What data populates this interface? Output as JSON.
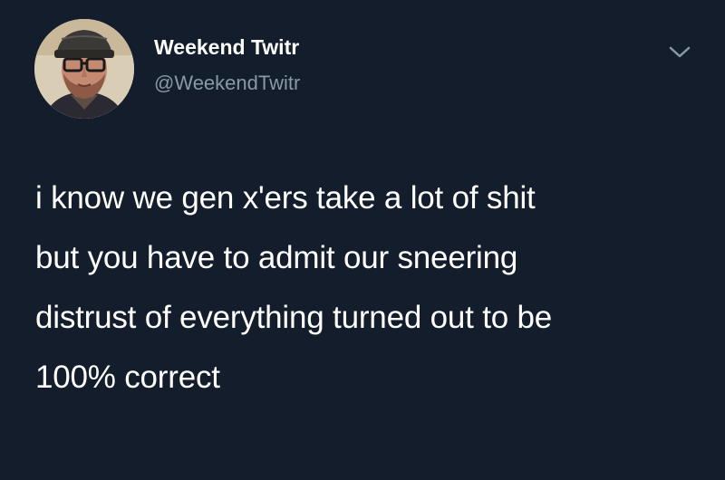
{
  "tweet": {
    "author": {
      "display_name": "Weekend Twitr",
      "handle": "@WeekendTwitr"
    },
    "text_lines": [
      "i know we gen x'ers take a lot of shit",
      "but you have to admit our sneering",
      "distrust of everything turned out to be",
      "100% correct"
    ],
    "menu_icon": "chevron-down-icon"
  },
  "colors": {
    "background": "#141d2b",
    "text": "#ffffff",
    "secondary_text": "#8899a6"
  }
}
